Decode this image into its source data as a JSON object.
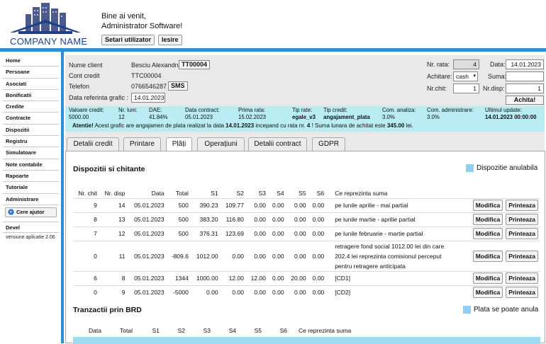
{
  "header": {
    "company": "COMPANY NAME",
    "welcome_line1": "Bine ai venit,",
    "welcome_line2": "Administrator Software!",
    "btn_settings": "Setari utilizator",
    "btn_logout": "Iesire"
  },
  "sidebar": {
    "items": [
      "Home",
      "Persoane",
      "Asociati",
      "Bonificatii",
      "Credite",
      "Contracte",
      "Dispozitii",
      "Registru",
      "Simulatoare",
      "Note contabile",
      "Rapoarte",
      "Tutoriale",
      "Administrare"
    ],
    "help_button": "Cere ajutor",
    "devel": "Devel",
    "version": "versiune aplicatie 2.06"
  },
  "client": {
    "name_label": "Nume client",
    "name_value": "Besciu Alexandru",
    "name_code": "TT00004",
    "account_label": "Cont credit",
    "account_value": "TTC00004",
    "phone_label": "Telefon",
    "phone_value": "0766546287",
    "sms_button": "SMS",
    "ref_date_label": "Data referinta grafic :",
    "ref_date_value": "14.01.2023"
  },
  "payment": {
    "rate_no_label": "Nr. rata:",
    "rate_no_value": "4",
    "date_label": "Data:",
    "date_value": "14.01.2023",
    "method_label": "Achitare:",
    "method_value": "cash",
    "sum_label": "Suma:",
    "sum_value": "",
    "receipt_label": "Nr.chit:",
    "receipt_value": "1",
    "disp_label": "Nr.disp:",
    "disp_value": "1",
    "pay_button": "Achita!"
  },
  "stats": [
    {
      "label": "Valoare credit:",
      "value": "5000.00"
    },
    {
      "label": "Nr. luni:",
      "value": "12"
    },
    {
      "label": "DAE:",
      "value": "41.84%"
    },
    {
      "label": "Data contract:",
      "value": "05.01.2023"
    },
    {
      "label": "Prima rata:",
      "value": "15.02.2023"
    },
    {
      "label": "Tip rate:",
      "value": "egale_v3"
    },
    {
      "label": "Tip credit:",
      "value": "angajament_plata"
    },
    {
      "label": "Com. analiza:",
      "value": "3.0%"
    },
    {
      "label": "Com. administrare:",
      "value": "3.0%"
    },
    {
      "label": "Ultimul update:",
      "value": "14.01.2023 00:00:00"
    }
  ],
  "alert": {
    "prefix": "Atentie!",
    "text1": " Acest grafic are angajamen de plata realizat la data ",
    "date": "14.01.2023",
    "text2": " incepand cu rata nr. ",
    "rate": "4",
    "text3": " ! Suma lunara de achitat este ",
    "amount": "345.00",
    "text4": " lei."
  },
  "tabs": [
    "Detalii credit",
    "Printare",
    "Plăți",
    "Operațiuni",
    "Detalii contract",
    "GDPR"
  ],
  "dispositions": {
    "title": "Dispozitii si chitante",
    "legend": "Dispozitie anulabila",
    "headers": [
      "Nr. chit",
      "Nr. disp",
      "Data",
      "Total",
      "S1",
      "S2",
      "S3",
      "S4",
      "S5",
      "S6",
      "Ce reprezinta suma"
    ],
    "rows": [
      {
        "chit": "9",
        "disp": "14",
        "date": "05.01.2023",
        "total": "500",
        "s1": "390.23",
        "s2": "109.77",
        "s3": "0.00",
        "s4": "0.00",
        "s5": "0.00",
        "s6": "0.00",
        "desc": "pe lunile aprilie - mai partial"
      },
      {
        "chit": "8",
        "disp": "13",
        "date": "05.01.2023",
        "total": "500",
        "s1": "383.20",
        "s2": "116.80",
        "s3": "0.00",
        "s4": "0.00",
        "s5": "0.00",
        "s6": "0.00",
        "desc": "pe lunile martie - aprilie partial"
      },
      {
        "chit": "7",
        "disp": "12",
        "date": "05.01.2023",
        "total": "500",
        "s1": "376.31",
        "s2": "123.69",
        "s3": "0.00",
        "s4": "0.00",
        "s5": "0.00",
        "s6": "0.00",
        "desc": "pe lunile februarie - martie partial"
      },
      {
        "chit": "0",
        "disp": "11",
        "date": "05.01.2023",
        "total": "-809.6",
        "s1": "1012.00",
        "s2": "0.00",
        "s3": "0.00",
        "s4": "0.00",
        "s5": "0.00",
        "s6": "0.00",
        "desc": "retragere fond social 1012.00 lei din care 202.4 lei reprezinta comisionul perceput pentru retragere anticipata"
      },
      {
        "chit": "6",
        "disp": "8",
        "date": "05.01.2023",
        "total": "1344",
        "s1": "1000.00",
        "s2": "12.00",
        "s3": "12.00",
        "s4": "0.00",
        "s5": "20.00",
        "s6": "0.00",
        "desc": "[CD1]"
      },
      {
        "chit": "0",
        "disp": "9",
        "date": "05.01.2023",
        "total": "-5000",
        "s1": "0.00",
        "s2": "0.00",
        "s3": "0.00",
        "s4": "0.00",
        "s5": "0.00",
        "s6": "0.00",
        "desc": "[CD2]"
      }
    ],
    "modify_label": "Modifica",
    "print_label": "Printeaza"
  },
  "transactions": {
    "title": "Tranzactii prin BRD",
    "legend": "Plata se poate anula",
    "headers": [
      "Data",
      "Total",
      "S1",
      "S2",
      "S3",
      "S4",
      "S5",
      "S6",
      "Ce reprezinta suma"
    ]
  }
}
